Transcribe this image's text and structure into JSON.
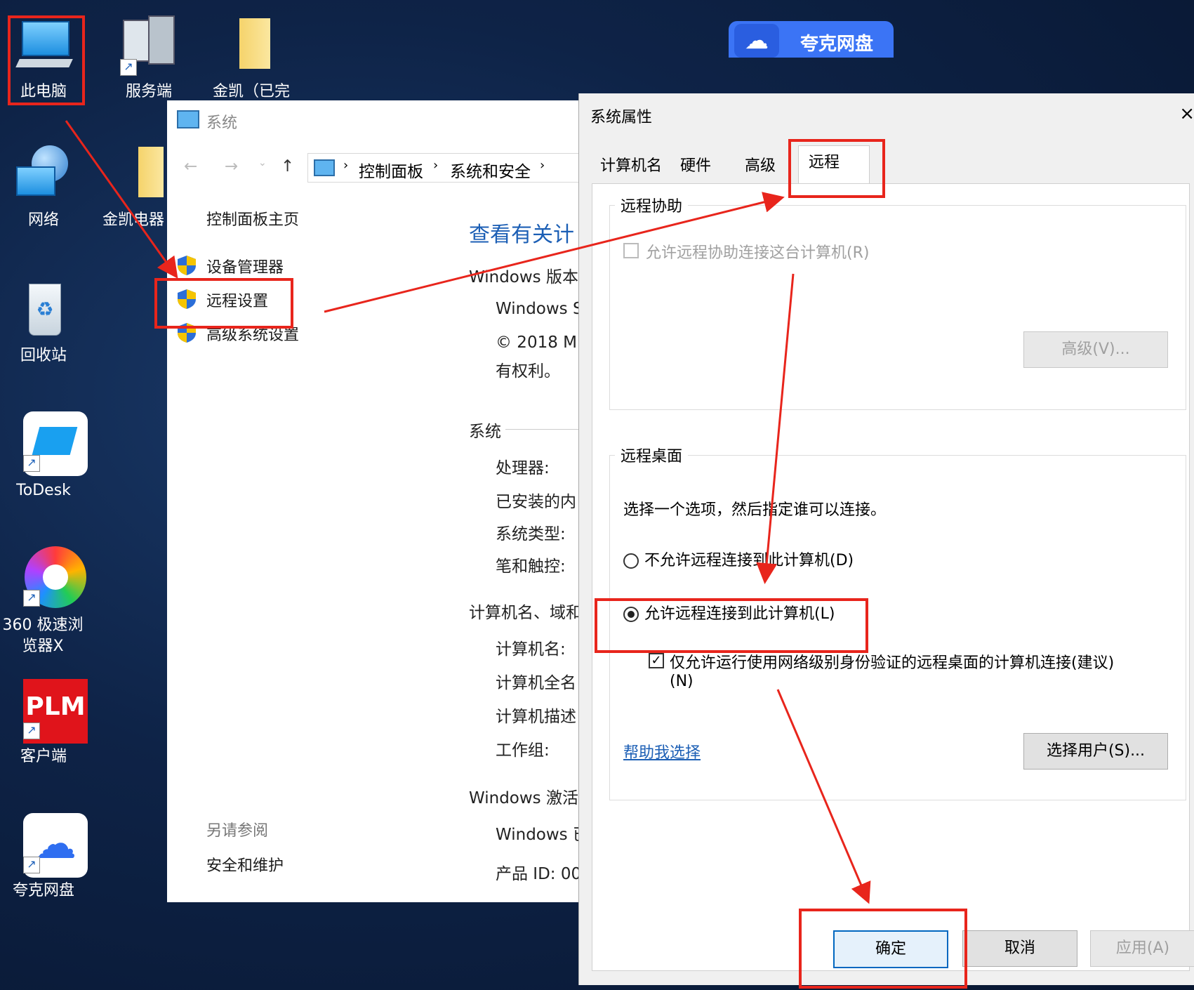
{
  "desktop": {
    "icons": [
      {
        "label": "此电脑"
      },
      {
        "label": "服务端"
      },
      {
        "label": "金凯（已完"
      },
      {
        "label": "网络"
      },
      {
        "label": "金凯电器"
      },
      {
        "label": "回收站"
      },
      {
        "label": "ToDesk"
      },
      {
        "label": "360 极速浏览器X"
      },
      {
        "label": "客户端"
      },
      {
        "label": "夸克网盘"
      }
    ],
    "plm_text": "PLM",
    "quark_bar": "夸克网盘"
  },
  "control_panel": {
    "title": "系统",
    "breadcrumb": [
      "控制面板",
      "系统和安全"
    ],
    "side_home": "控制面板主页",
    "side_links": [
      "设备管理器",
      "远程设置",
      "高级系统设置"
    ],
    "see_also": "另请参阅",
    "see_also_link": "安全和维护",
    "heading": "查看有关计",
    "lines": [
      "Windows 版本",
      "Windows S",
      "© 2018 M",
      "有权利。",
      "系统",
      "处理器:",
      "已安装的内",
      "系统类型:",
      "笔和触控:",
      "计算机名、域和",
      "计算机名:",
      "计算机全名",
      "计算机描述",
      "工作组:",
      "Windows 激活",
      "Windows 已",
      "产品 ID: 00"
    ]
  },
  "system_properties": {
    "title": "系统属性",
    "close": "×",
    "tabs": [
      "计算机名",
      "硬件",
      "高级",
      "远程"
    ],
    "remote_assist": {
      "group": "远程协助",
      "checkbox": "允许远程协助连接这台计算机(R)",
      "advanced_btn": "高级(V)..."
    },
    "remote_desktop": {
      "group": "远程桌面",
      "desc": "选择一个选项，然后指定谁可以连接。",
      "opt_deny": "不允许远程连接到此计算机(D)",
      "opt_allow": "允许远程连接到此计算机(L)",
      "nla_line1": "仅允许运行使用网络级别身份验证的远程桌面的计算机连接(建议)",
      "nla_line2": "(N)",
      "help_link": "帮助我选择",
      "select_users_btn": "选择用户(S)..."
    },
    "buttons": {
      "ok": "确定",
      "cancel": "取消",
      "apply": "应用(A)"
    }
  },
  "colors": {
    "annotation": "#e8251c",
    "link": "#1c5fb5"
  }
}
